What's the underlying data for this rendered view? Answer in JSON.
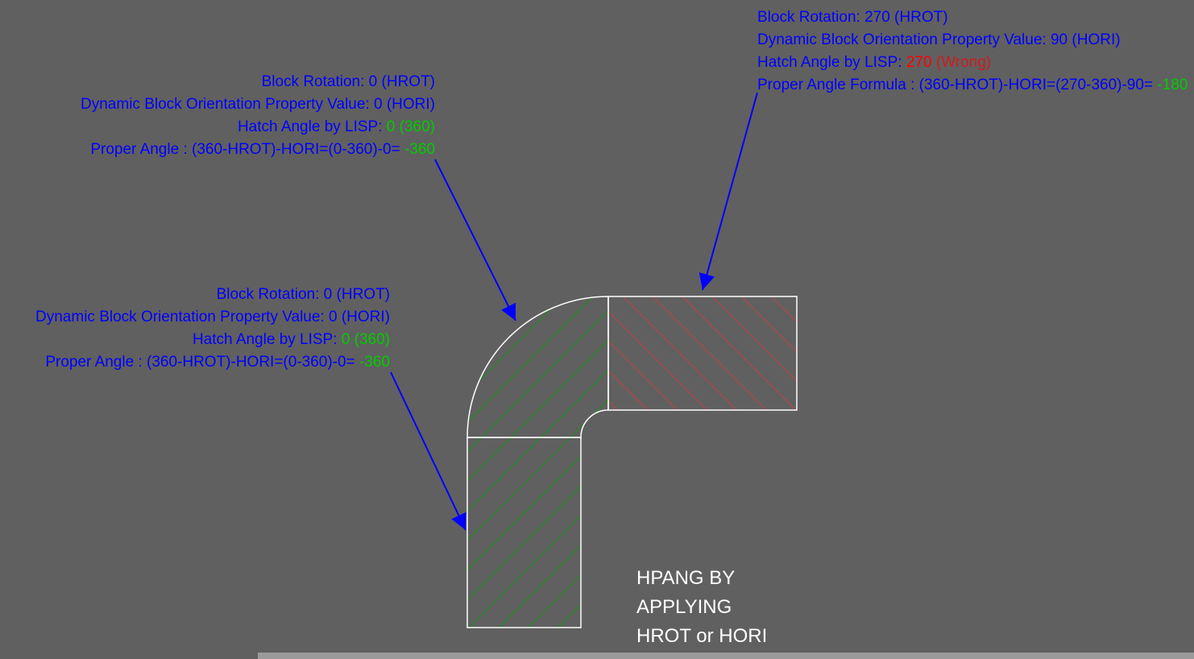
{
  "annotation1": {
    "line1_label": "Block Rotation:",
    "line1_value": " 0  (HROT)",
    "line2_label": "Dynamic Block Orientation Property Value:",
    "line2_value": "  0  (HORI)",
    "line3_label": "Hatch Angle by LISP:",
    "line3_value": " 0 (360)",
    "line4_label": "Proper Angle : (360-HROT)-HORI=(0-360)-0=",
    "line4_value": " -360"
  },
  "annotation2": {
    "line1_label": "Block Rotation:",
    "line1_value": " 0  (HROT)",
    "line2_label": "Dynamic Block Orientation Property Value:",
    "line2_value": "  0  (HORI)",
    "line3_label": "Hatch Angle by LISP:",
    "line3_value": " 0 (360)",
    "line4_label": "Proper Angle : (360-HROT)-HORI=(0-360)-0=",
    "line4_value": " -360"
  },
  "annotation3": {
    "line1_label": "Block Rotation:",
    "line1_value": " 270 (HROT)",
    "line2_label": "Dynamic Block Orientation Property Value:",
    "line2_value": " 90 (HORI)",
    "line3_label": "Hatch Angle by LISP: ",
    "line3_value_red": "270 ",
    "line3_value_wrong": "(Wrong)",
    "line4_label": "Proper Angle Formula : (360-HROT)-HORI=(270-360)-90=",
    "line4_value": " -180"
  },
  "caption": {
    "line1": "HPANG BY",
    "line2": "APPLYING",
    "line3": "HROT or HORI"
  }
}
